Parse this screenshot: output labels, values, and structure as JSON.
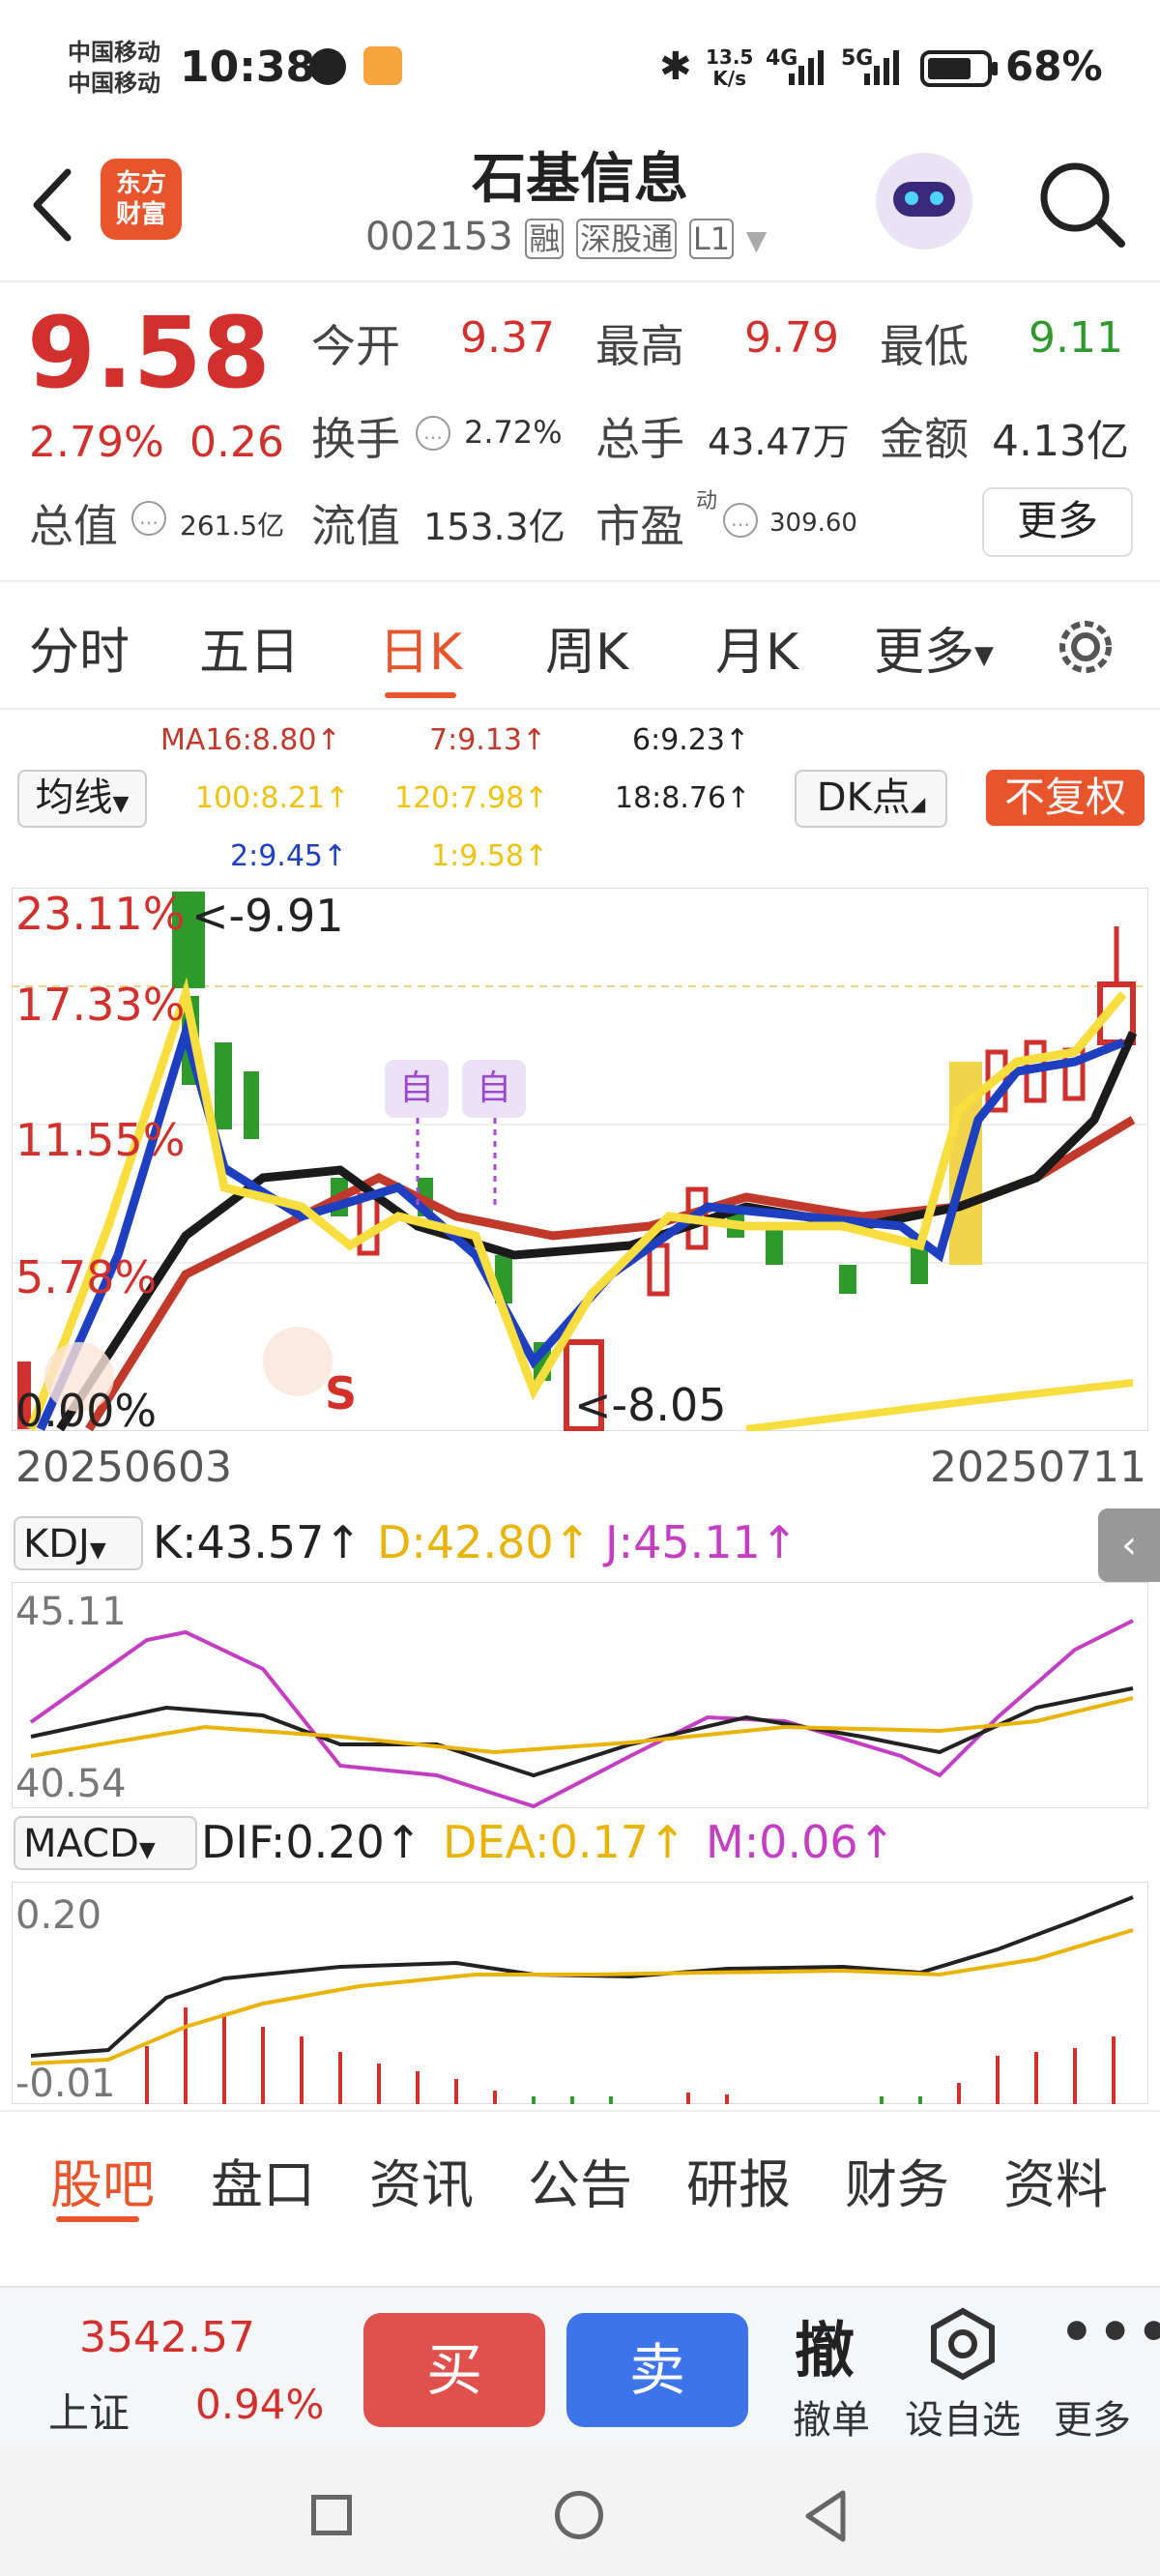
{
  "status_bar": {
    "carrier1": "中国移动",
    "carrier2": "中国移动",
    "time": "10:38",
    "net_speed_value": "13.5",
    "net_speed_unit": "K/s",
    "net1": "4G",
    "net2": "5G",
    "battery": "68%"
  },
  "header": {
    "brand_line1": "东方",
    "brand_line2": "财富",
    "title": "石基信息",
    "code": "002153",
    "tag1": "融",
    "tag2": "深股通",
    "tag3": "L1"
  },
  "quote": {
    "price": "9.58",
    "change_pct": "2.79%",
    "change": "0.26",
    "open_label": "今开",
    "open": "9.37",
    "high_label": "最高",
    "high": "9.79",
    "low_label": "最低",
    "low": "9.11",
    "turnover_label": "换手",
    "turnover": "2.72%",
    "volume_label": "总手",
    "volume": "43.47万",
    "amount_label": "金额",
    "amount": "4.13亿",
    "mcap_label": "总值",
    "mcap": "261.5亿",
    "float_label": "流值",
    "float": "153.3亿",
    "pe_label": "市盈",
    "pe_sup": "动",
    "pe": "309.60",
    "more": "更多"
  },
  "ktabs": {
    "t1": "分时",
    "t2": "五日",
    "t3": "日K",
    "t4": "周K",
    "t5": "月K",
    "t6": "更多",
    "active": "日K"
  },
  "ma": {
    "selector": "均线",
    "ma16": "MA16:8.80↑",
    "ma7": "7:9.13↑",
    "ma6": "6:9.23↑",
    "ma100": "100:8.21↑",
    "ma120": "120:7.98↑",
    "ma18": "18:8.76↑",
    "ma2": "2:9.45↑",
    "ma1": "1:9.58↑",
    "dk": "DK点",
    "fq": "不复权"
  },
  "main_chart": {
    "y1": "23.11%",
    "y2": "17.33%",
    "y3": "11.55%",
    "y4": "5.78%",
    "y5": "0.00%",
    "max_note": "<-9.91",
    "min_note": "<-8.05",
    "tag_zi1": "自",
    "tag_zi2": "自",
    "sell_marker": "S",
    "date_start": "20250603",
    "date_end": "20250711"
  },
  "kdj": {
    "selector": "KDJ",
    "k": "K:43.57↑",
    "d": "D:42.80↑",
    "j": "J:45.11↑",
    "y_top": "45.11",
    "y_bottom": "40.54"
  },
  "macd": {
    "selector": "MACD",
    "dif": "DIF:0.20↑",
    "dea": "DEA:0.17↑",
    "m": "M:0.06↑",
    "y_top": "0.20",
    "y_bottom": "-0.01"
  },
  "bottom_tabs": {
    "b1": "股吧",
    "b2": "盘口",
    "b3": "资讯",
    "b4": "公告",
    "b5": "研报",
    "b6": "财务",
    "b7": "资料"
  },
  "footer": {
    "index_value": "3542.57",
    "index_name": "上证",
    "index_pct": "0.94%",
    "buy": "买",
    "sell": "卖",
    "cancel_icon_text": "撤",
    "cancel": "撤单",
    "watch": "设自选",
    "more": "更多"
  },
  "colors": {
    "red": "#d2302d",
    "green": "#2d9a2b",
    "gold": "#f1d44a",
    "blue": "#1e3fbf",
    "magenta": "#c43ec4",
    "orange": "#e8552c"
  }
}
